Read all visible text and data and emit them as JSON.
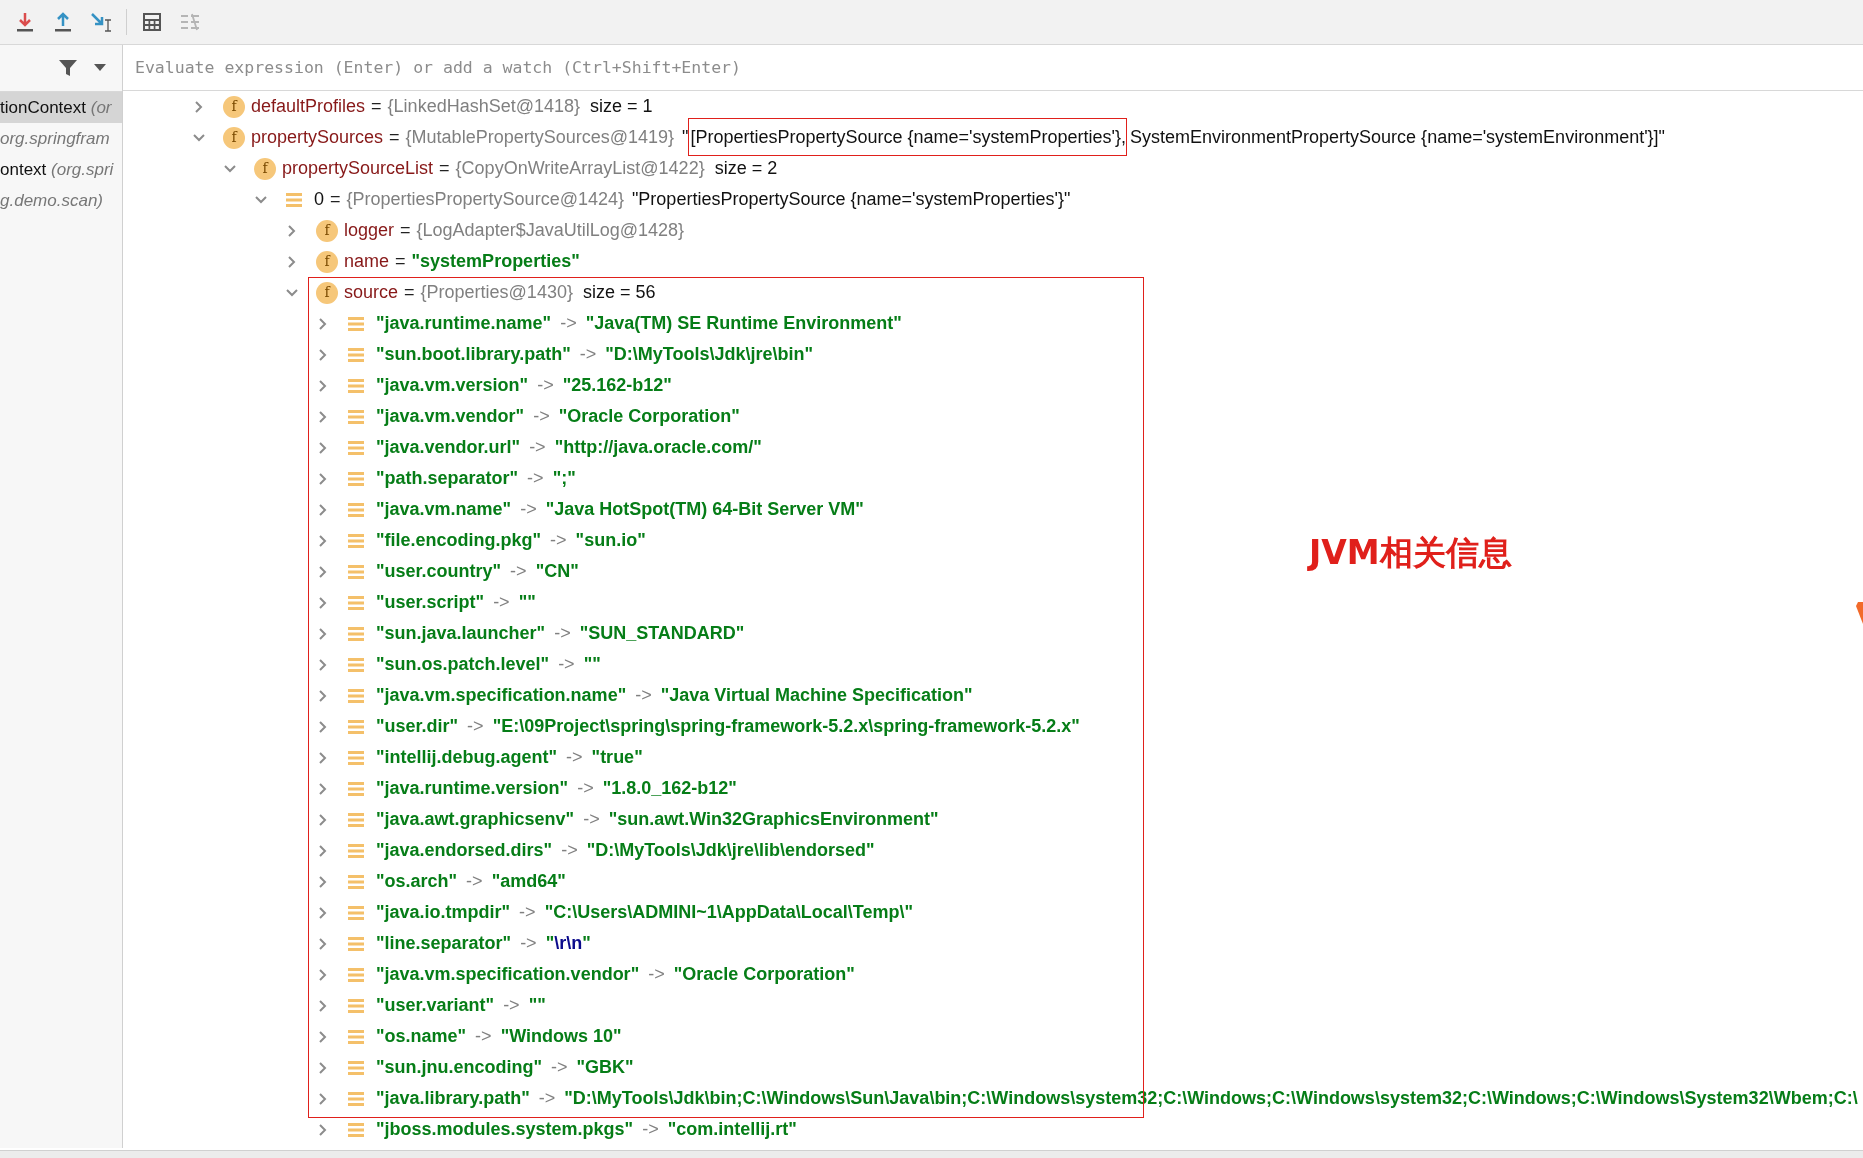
{
  "toolbar": {
    "buttons": [
      {
        "kind": "download"
      },
      {
        "kind": "upload"
      },
      {
        "kind": "step"
      },
      {
        "kind": "table",
        "separator_before": true
      },
      {
        "kind": "list",
        "disabled": true
      }
    ]
  },
  "frames": {
    "items": [
      {
        "method": "tionContext",
        "location": "(or",
        "selected": true
      },
      {
        "location": "org.springfram",
        "selected": false
      },
      {
        "method": "ontext",
        "location": "(org.spri",
        "selected": false
      },
      {
        "location": "g.demo.scan)",
        "selected": false
      }
    ]
  },
  "watch": {
    "placeholder": "Evaluate expression (Enter) or add a watch (Ctrl+Shift+Enter)"
  },
  "tree": [
    {
      "kind": "field",
      "badge": "f",
      "name": "defaultProfiles",
      "op": "=",
      "ref": "{LinkedHashSet@1418}",
      "extra": "size = 1",
      "expanded": false
    },
    {
      "kind": "field",
      "badge": "f",
      "name": "propertySources",
      "op": "=",
      "ref": "{MutablePropertySources@1419}",
      "text_parts": [
        {
          "text": "\"",
          "highlighted": false
        },
        {
          "text": "[PropertiesPropertySource {name='systemProperties'},",
          "highlighted": true
        },
        {
          "text": " SystemEnvironmentPropertySource {name='systemEnvironment'}]\"",
          "highlighted": false
        }
      ],
      "expanded": true,
      "children": [
        {
          "kind": "field",
          "badge": "f",
          "name": "propertySourceList",
          "op": "=",
          "ref": "{CopyOnWriteArrayList@1422}",
          "extra": "size = 2",
          "expanded": true,
          "children": [
            {
              "kind": "element",
              "name": "0",
              "op": "=",
              "ref": "{PropertiesPropertySource@1424}",
              "text": "\"PropertiesPropertySource {name='systemProperties'}\"",
              "expanded": true,
              "children": [
                {
                  "kind": "field",
                  "badge": "f",
                  "name": "logger",
                  "op": "=",
                  "ref": "{LogAdapter$JavaUtilLog@1428}",
                  "expanded": false
                },
                {
                  "kind": "field",
                  "badge": "f",
                  "name": "name",
                  "op": "=",
                  "string": "\"systemProperties\"",
                  "expanded": false
                },
                {
                  "kind": "field",
                  "badge": "f",
                  "name": "source",
                  "op": "=",
                  "ref": "{Properties@1430}",
                  "extra": "size = 56",
                  "expanded": true,
                  "children": [
                    {
                      "kind": "entry",
                      "key": "\"java.runtime.name\"",
                      "op": "->",
                      "value": "\"Java(TM) SE Runtime Environment\"",
                      "expanded": false
                    },
                    {
                      "kind": "entry",
                      "key": "\"sun.boot.library.path\"",
                      "op": "->",
                      "value": "\"D:\\MyTools\\Jdk\\jre\\bin\"",
                      "expanded": false
                    },
                    {
                      "kind": "entry",
                      "key": "\"java.vm.version\"",
                      "op": "->",
                      "value": "\"25.162-b12\"",
                      "expanded": false
                    },
                    {
                      "kind": "entry",
                      "key": "\"java.vm.vendor\"",
                      "op": "->",
                      "value": "\"Oracle Corporation\"",
                      "expanded": false
                    },
                    {
                      "kind": "entry",
                      "key": "\"java.vendor.url\"",
                      "op": "->",
                      "value": "\"http://java.oracle.com/\"",
                      "expanded": false
                    },
                    {
                      "kind": "entry",
                      "key": "\"path.separator\"",
                      "op": "->",
                      "value": "\";\"",
                      "expanded": false
                    },
                    {
                      "kind": "entry",
                      "key": "\"java.vm.name\"",
                      "op": "->",
                      "value": "\"Java HotSpot(TM) 64-Bit Server VM\"",
                      "expanded": false
                    },
                    {
                      "kind": "entry",
                      "key": "\"file.encoding.pkg\"",
                      "op": "->",
                      "value": "\"sun.io\"",
                      "expanded": false
                    },
                    {
                      "kind": "entry",
                      "key": "\"user.country\"",
                      "op": "->",
                      "value": "\"CN\"",
                      "expanded": false
                    },
                    {
                      "kind": "entry",
                      "key": "\"user.script\"",
                      "op": "->",
                      "value": "\"\"",
                      "expanded": false
                    },
                    {
                      "kind": "entry",
                      "key": "\"sun.java.launcher\"",
                      "op": "->",
                      "value": "\"SUN_STANDARD\"",
                      "expanded": false
                    },
                    {
                      "kind": "entry",
                      "key": "\"sun.os.patch.level\"",
                      "op": "->",
                      "value": "\"\"",
                      "expanded": false
                    },
                    {
                      "kind": "entry",
                      "key": "\"java.vm.specification.name\"",
                      "op": "->",
                      "value": "\"Java Virtual Machine Specification\"",
                      "expanded": false
                    },
                    {
                      "kind": "entry",
                      "key": "\"user.dir\"",
                      "op": "->",
                      "value": "\"E:\\09Project\\spring\\spring-framework-5.2.x\\spring-framework-5.2.x\"",
                      "expanded": false
                    },
                    {
                      "kind": "entry",
                      "key": "\"intellij.debug.agent\"",
                      "op": "->",
                      "value": "\"true\"",
                      "expanded": false
                    },
                    {
                      "kind": "entry",
                      "key": "\"java.runtime.version\"",
                      "op": "->",
                      "value": "\"1.8.0_162-b12\"",
                      "expanded": false
                    },
                    {
                      "kind": "entry",
                      "key": "\"java.awt.graphicsenv\"",
                      "op": "->",
                      "value": "\"sun.awt.Win32GraphicsEnvironment\"",
                      "expanded": false
                    },
                    {
                      "kind": "entry",
                      "key": "\"java.endorsed.dirs\"",
                      "op": "->",
                      "value": "\"D:\\MyTools\\Jdk\\jre\\lib\\endorsed\"",
                      "expanded": false
                    },
                    {
                      "kind": "entry",
                      "key": "\"os.arch\"",
                      "op": "->",
                      "value": "\"amd64\"",
                      "expanded": false
                    },
                    {
                      "kind": "entry",
                      "key": "\"java.io.tmpdir\"",
                      "op": "->",
                      "value": "\"C:\\Users\\ADMINI~1\\AppData\\Local\\Temp\\\"",
                      "expanded": false
                    },
                    {
                      "kind": "entry",
                      "key": "\"line.separator\"",
                      "op": "->",
                      "value_segments": [
                        {
                          "kind": "string",
                          "text": "\""
                        },
                        {
                          "kind": "escape",
                          "text": "\\r\\n"
                        },
                        {
                          "kind": "string",
                          "text": "\""
                        }
                      ],
                      "expanded": false
                    },
                    {
                      "kind": "entry",
                      "key": "\"java.vm.specification.vendor\"",
                      "op": "->",
                      "value": "\"Oracle Corporation\"",
                      "expanded": false
                    },
                    {
                      "kind": "entry",
                      "key": "\"user.variant\"",
                      "op": "->",
                      "value": "\"\"",
                      "expanded": false
                    },
                    {
                      "kind": "entry",
                      "key": "\"os.name\"",
                      "op": "->",
                      "value": "\"Windows 10\"",
                      "expanded": false
                    },
                    {
                      "kind": "entry",
                      "key": "\"sun.jnu.encoding\"",
                      "op": "->",
                      "value": "\"GBK\"",
                      "expanded": false
                    },
                    {
                      "kind": "entry",
                      "key": "\"java.library.path\"",
                      "op": "->",
                      "value": "\"D:\\MyTools\\Jdk\\bin;C:\\Windows\\Sun\\Java\\bin;C:\\Windows\\system32;C:\\Windows;C:\\Windows\\system32;C:\\Windows;C:\\Windows\\System32\\Wbem;C:\\",
                      "expanded": false
                    },
                    {
                      "kind": "entry",
                      "key": "\"jboss.modules.system.pkgs\"",
                      "op": "->",
                      "value": "\"com.intellij.rt\"",
                      "expanded": false
                    }
                  ]
                }
              ]
            }
          ]
        }
      ]
    }
  ],
  "annotation": {
    "label": "JVM相关信息"
  }
}
